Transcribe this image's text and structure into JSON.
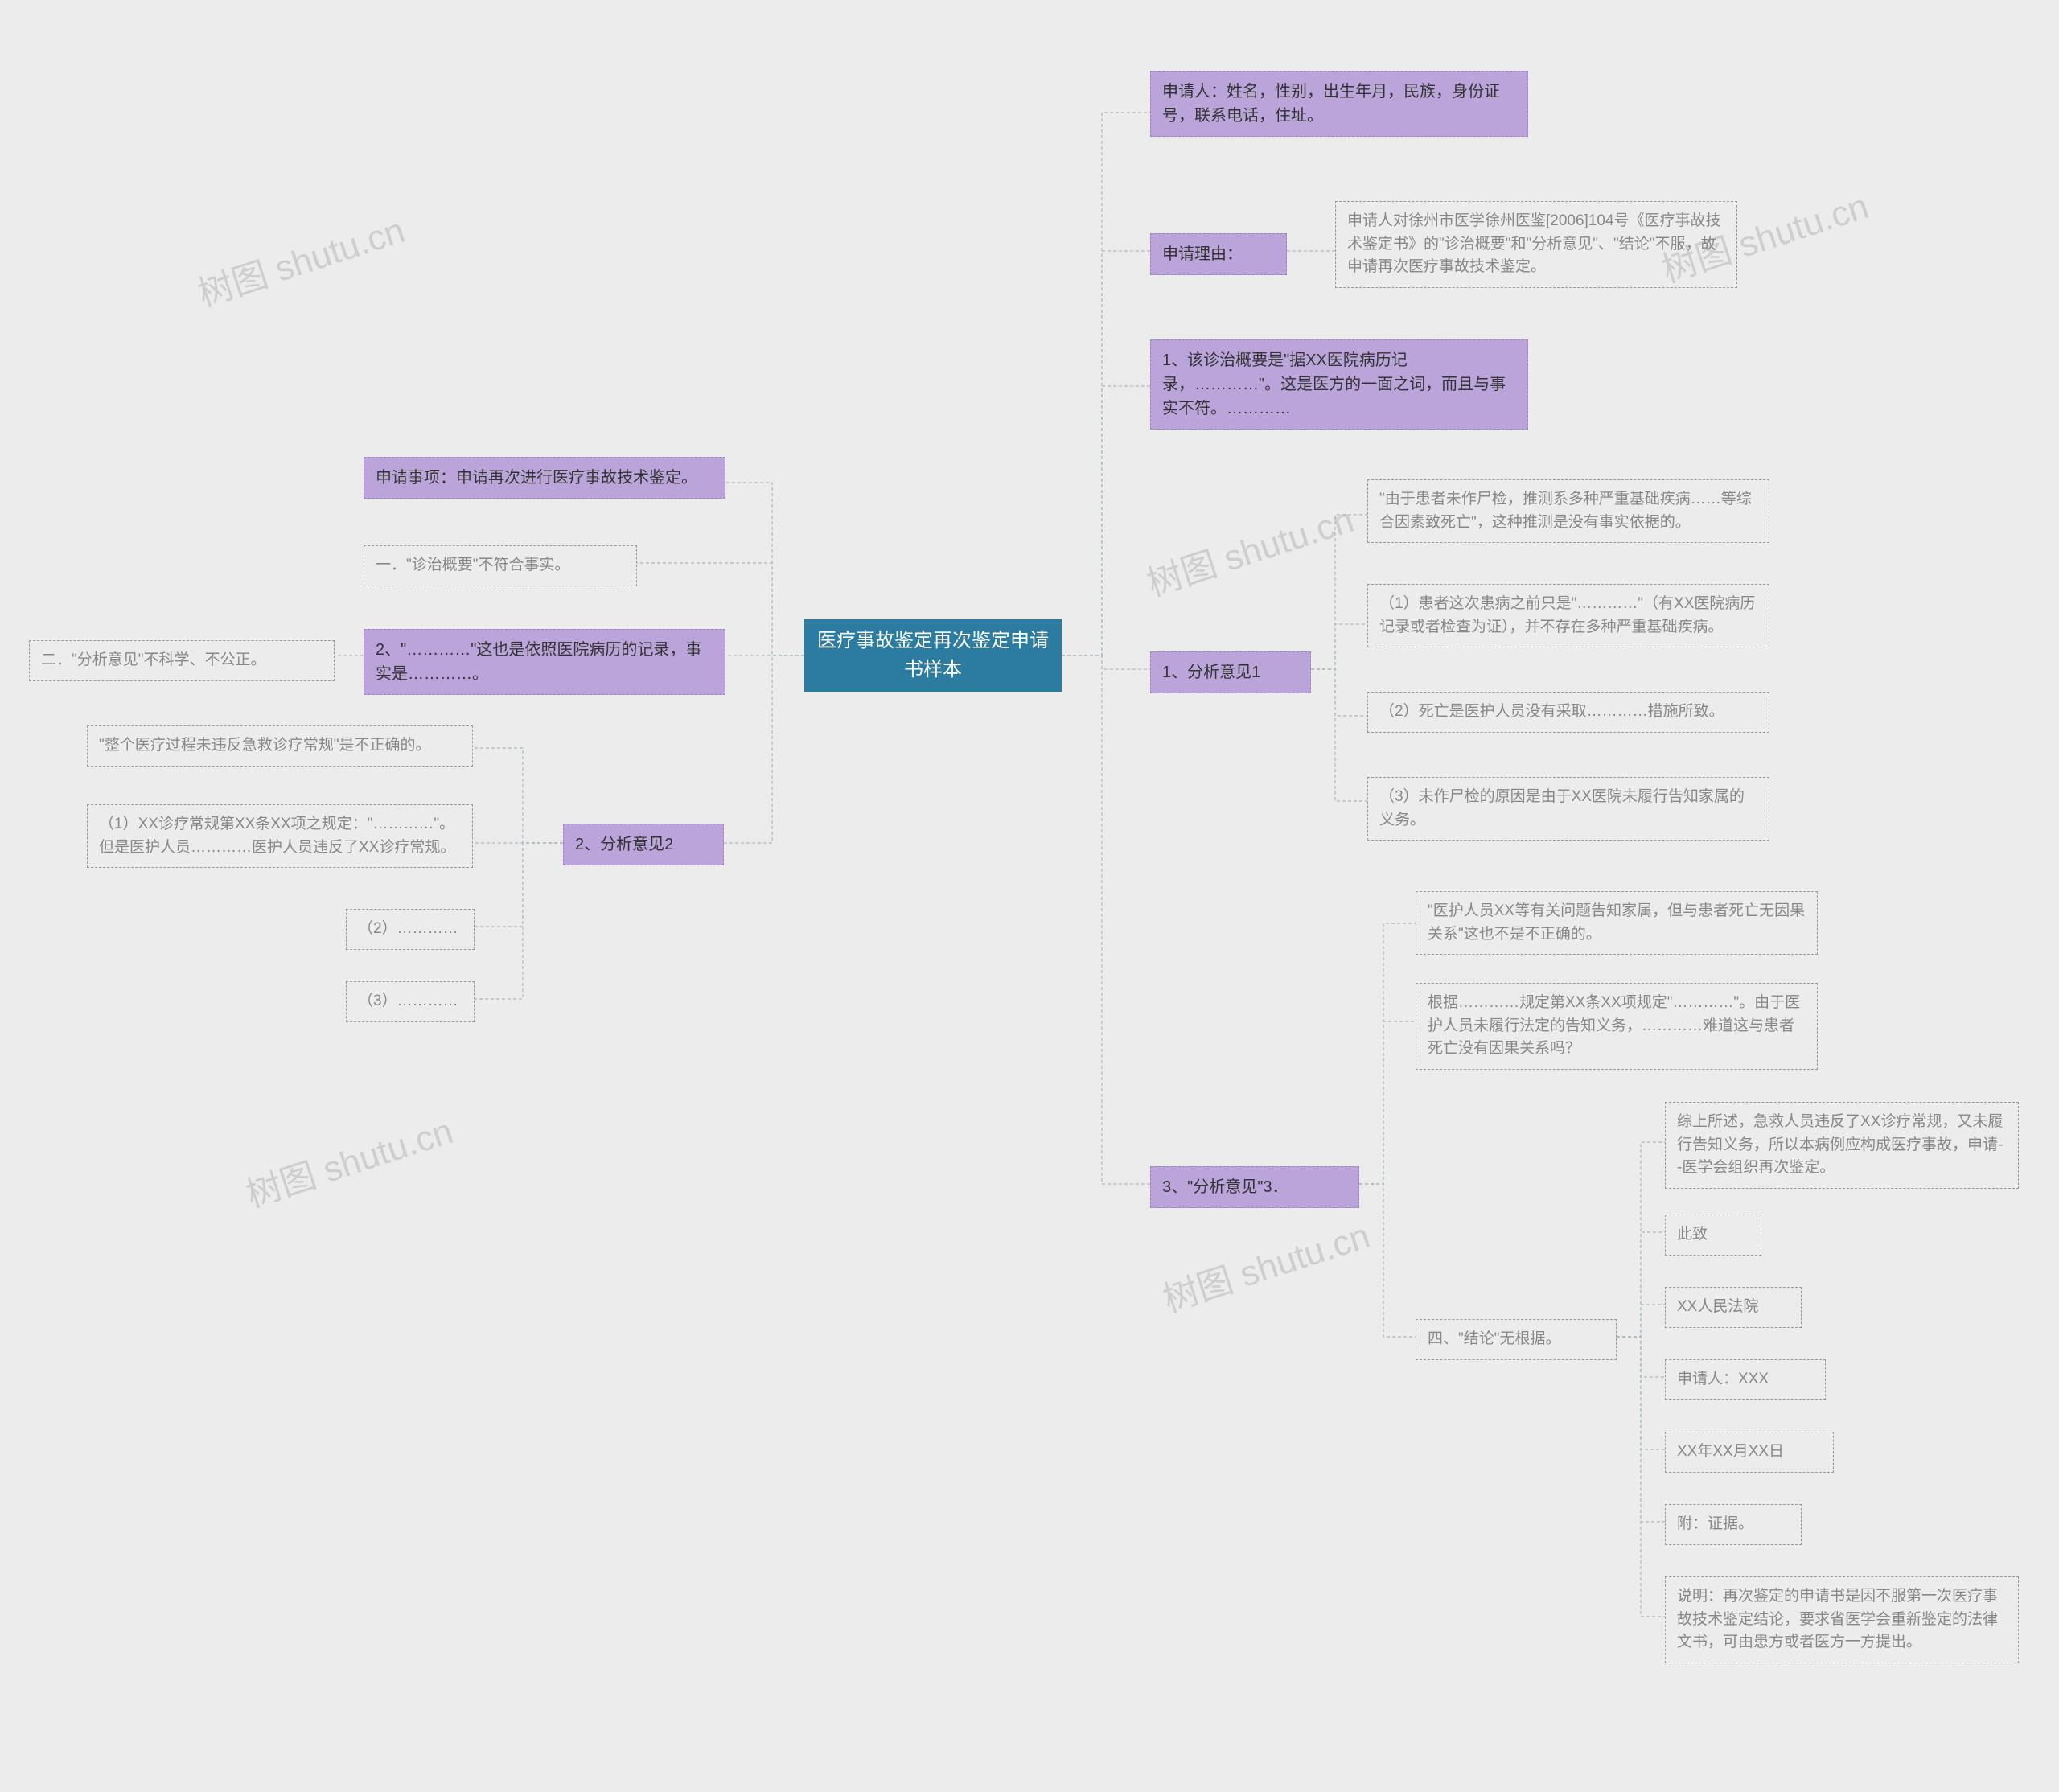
{
  "root": "医疗事故鉴定再次鉴定申请书样本",
  "watermark": "树图 shutu.cn",
  "left": {
    "item1": "申请事项：申请再次进行医疗事故技术鉴定。",
    "item1_child": "一．\"诊治概要\"不符合事实。",
    "item2": "2、\"…………\"这也是依照医院病历的记录，事实是…………。",
    "item2_child": "二．\"分析意见\"不科学、不公正。",
    "analysis2": "2、分析意见2",
    "a2_c1": "\"整个医疗过程未违反急救诊疗常规\"是不正确的。",
    "a2_c2": "（1）XX诊疗常规第XX条XX项之规定：\"…………\"。但是医护人员…………医护人员违反了XX诊疗常规。",
    "a2_c3": "（2）…………",
    "a2_c4": "（3）…………"
  },
  "right": {
    "applicant": "申请人：姓名，性别，出生年月，民族，身份证号，联系电话，住址。",
    "reason": "申请理由：",
    "reason_detail": "申请人对徐州市医学徐州医鉴[2006]104号《医疗事故技术鉴定书》的\"诊治概要\"和\"分析意见\"、\"结论\"不服，故申请再次医疗事故技术鉴定。",
    "diag": "1、该诊治概要是\"据XX医院病历记录，…………\"。这是医方的一面之词，而且与事实不符。…………",
    "analysis1": "1、分析意见1",
    "a1_c1": "\"由于患者未作尸检，推测系多种严重基础疾病……等综合因素致死亡\"，这种推测是没有事实依据的。",
    "a1_c2": "（1）患者这次患病之前只是\"…………\"（有XX医院病历记录或者检查为证），并不存在多种严重基础疾病。",
    "a1_c3": "（2）死亡是医护人员没有采取…………措施所致。",
    "a1_c4": "（3）未作尸检的原因是由于XX医院未履行告知家属的义务。",
    "analysis3": "3、\"分析意见\"3．",
    "a3_c1": "\"医护人员XX等有关问题告知家属，但与患者死亡无因果关系\"这也不是不正确的。",
    "a3_c2": "根据…………规定第XX条XX项规定\"…………\"。由于医护人员未履行法定的告知义务，…………难道这与患者死亡没有因果关系吗？",
    "conclusion": "四、\"结论\"无根据。",
    "c_c1": "综上所述，急救人员违反了XX诊疗常规，又未履行告知义务，所以本病例应构成医疗事故，申请--医学会组织再次鉴定。",
    "c_c2": "此致",
    "c_c3": "XX人民法院",
    "c_c4": "申请人：XXX",
    "c_c5": "XX年XX月XX日",
    "c_c6": "附：证据。",
    "c_c7": "说明：再次鉴定的申请书是因不服第一次医疗事故技术鉴定结论，要求省医学会重新鉴定的法律文书，可由患方或者医方一方提出。"
  }
}
